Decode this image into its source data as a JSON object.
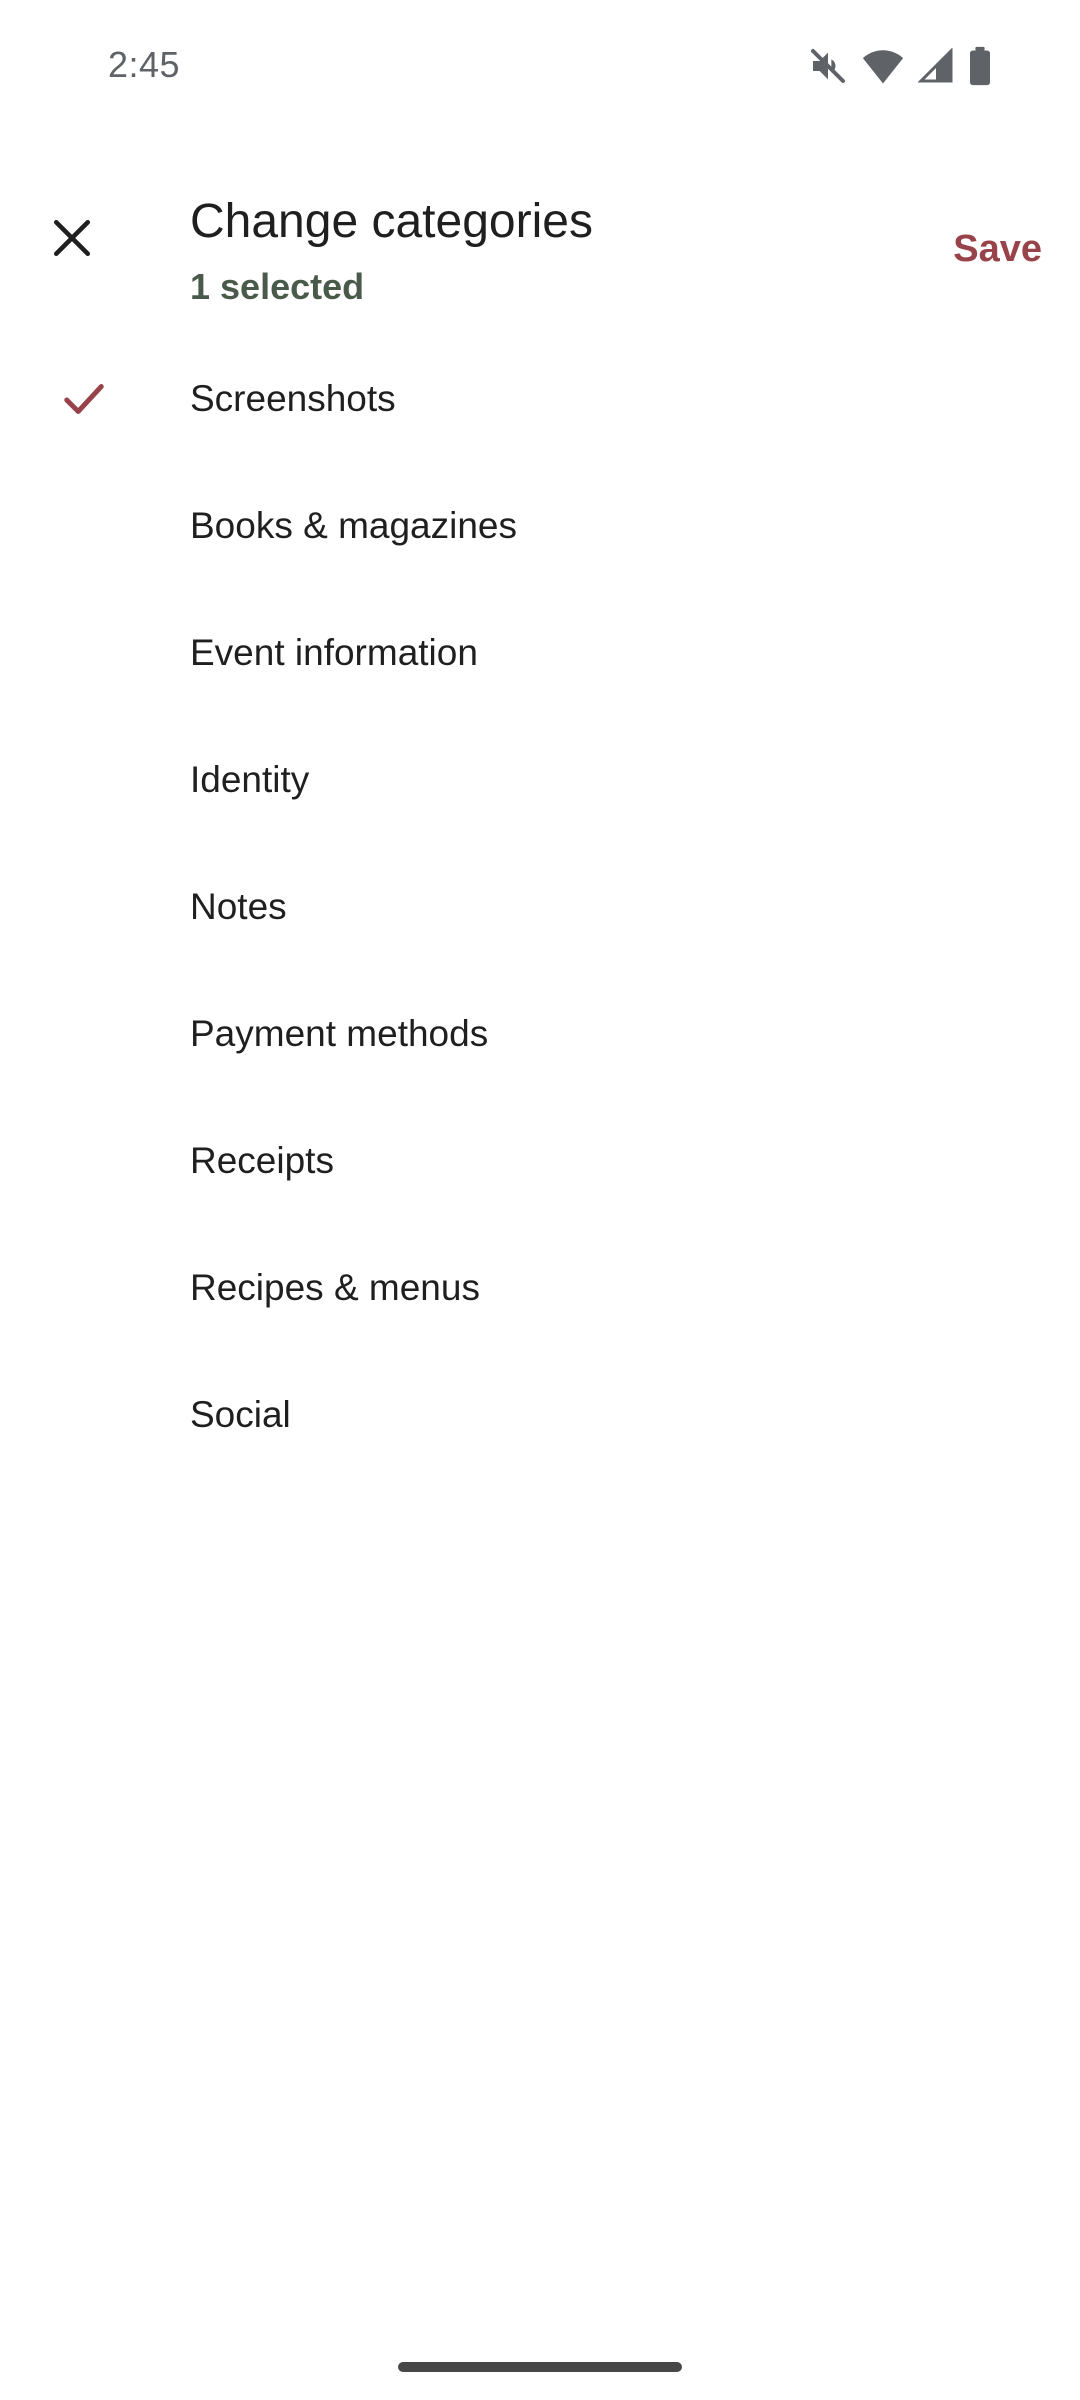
{
  "status_bar": {
    "time": "2:45",
    "icons": [
      "mute-icon",
      "wifi-icon",
      "signal-icon",
      "battery-icon"
    ]
  },
  "header": {
    "title": "Change categories",
    "subtitle": "1 selected",
    "save_label": "Save",
    "close_icon": "close-icon"
  },
  "categories": [
    {
      "label": "Screenshots",
      "selected": true
    },
    {
      "label": "Books & magazines",
      "selected": false
    },
    {
      "label": "Event information",
      "selected": false
    },
    {
      "label": "Identity",
      "selected": false
    },
    {
      "label": "Notes",
      "selected": false
    },
    {
      "label": "Payment methods",
      "selected": false
    },
    {
      "label": "Receipts",
      "selected": false
    },
    {
      "label": "Recipes & menus",
      "selected": false
    },
    {
      "label": "Social",
      "selected": false
    }
  ],
  "colors": {
    "accent": "#98424a",
    "subtitle": "#4a5a4a",
    "text": "#1f1f1f",
    "status_text": "#5f6368"
  }
}
